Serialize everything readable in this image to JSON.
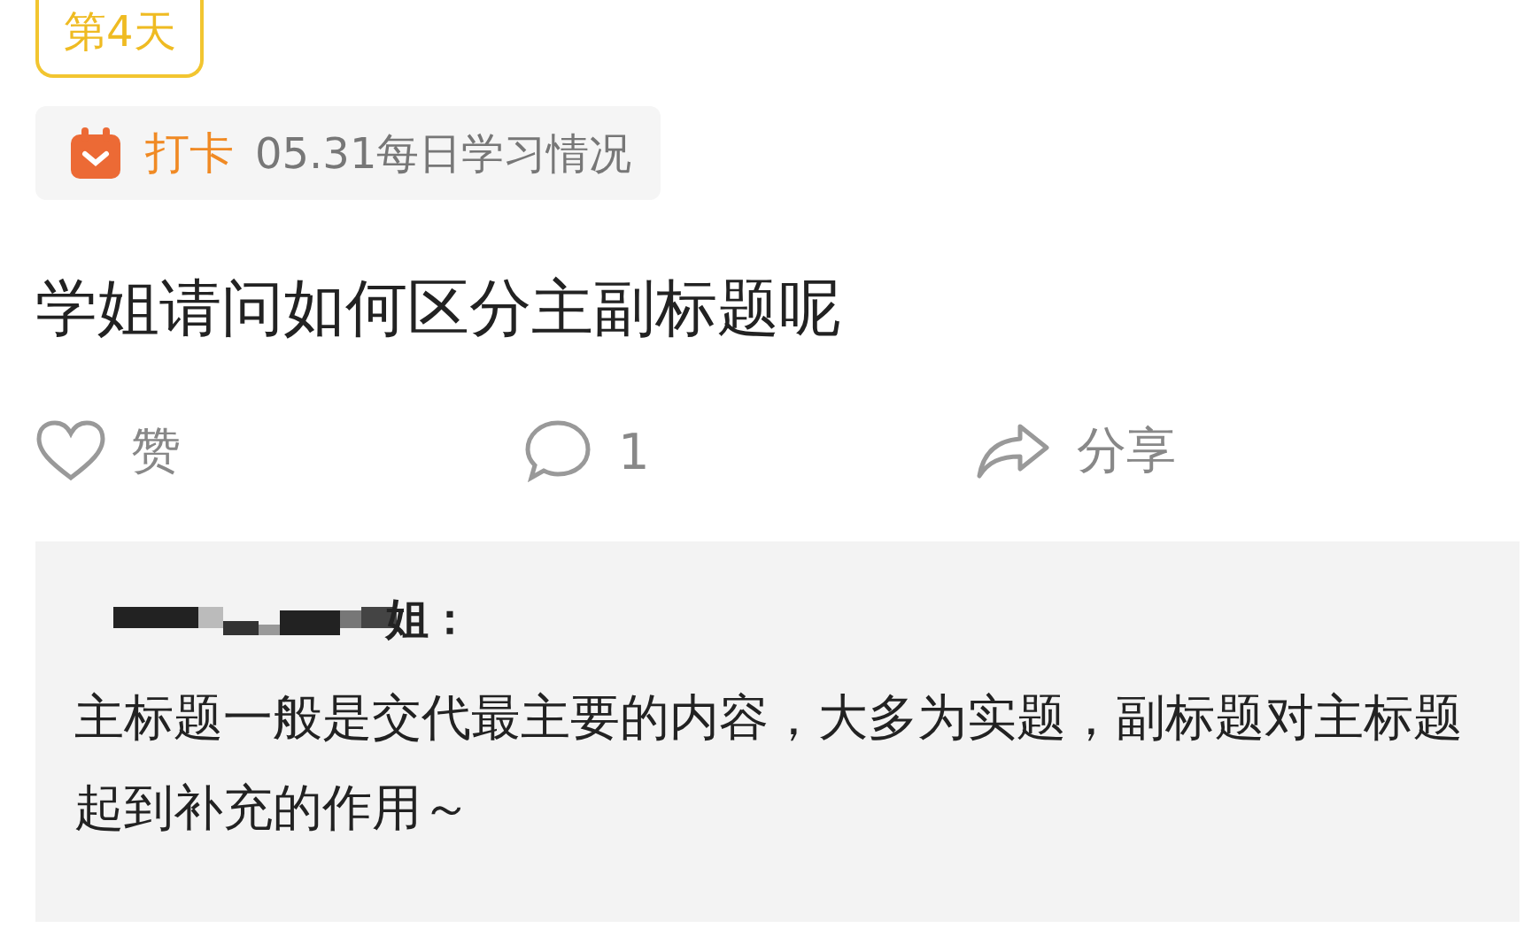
{
  "day_badge": "第4天",
  "checkin": {
    "label": "打卡",
    "topic": "05.31每日学习情况"
  },
  "post_title": "学姐请问如何区分主副标题呢",
  "actions": [
    {
      "kind": "like",
      "label": "赞"
    },
    {
      "kind": "comment",
      "label": "1"
    },
    {
      "kind": "share",
      "label": "分享"
    }
  ],
  "comment": {
    "author": "姐：",
    "text": "主标题一般是交代最主要的内容，大多为实题，副标题对主标题起到补充的作用～"
  }
}
